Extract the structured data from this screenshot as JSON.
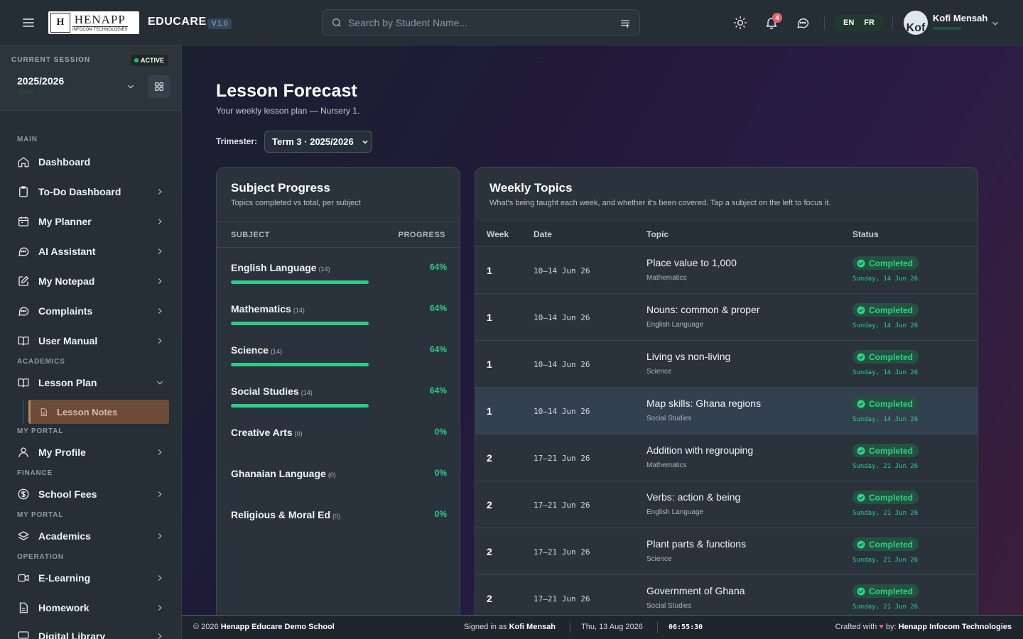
{
  "header": {
    "logo": {
      "mark": "H",
      "main": "HENAPP",
      "sub": "INFOCOM TECHNOLOGIES"
    },
    "brand": "EDUCARE",
    "version": "V.1.0",
    "search_placeholder": "Search by Student Name...",
    "notification_count": "4",
    "languages": [
      "EN",
      "FR"
    ],
    "user_name": "Kofi Mensah",
    "avatar_initials": "Kof"
  },
  "session": {
    "label": "CURRENT SESSION",
    "status": "ACTIVE",
    "year": "2025/2026",
    "term": "Term 3"
  },
  "sidebar": {
    "sections": {
      "main": "MAIN",
      "academics": "ACADEMICS",
      "my_portal": "MY PORTAL",
      "finance": "FINANCE",
      "my_portal_2": "MY PORTAL",
      "operation": "OPERATION"
    },
    "items": [
      {
        "label": "Dashboard",
        "icon": "home-icon"
      },
      {
        "label": "To-Do Dashboard",
        "icon": "clipboard-icon"
      },
      {
        "label": "My Planner",
        "icon": "calendar-icon"
      },
      {
        "label": "AI Assistant",
        "icon": "chat-icon"
      },
      {
        "label": "My Notepad",
        "icon": "edit-icon"
      },
      {
        "label": "Complaints",
        "icon": "chat-icon"
      },
      {
        "label": "User Manual",
        "icon": "book-icon"
      },
      {
        "label": "Lesson Plan",
        "icon": "book-icon"
      },
      {
        "label": "My Profile",
        "icon": "user-icon"
      },
      {
        "label": "School Fees",
        "icon": "dollar-icon"
      },
      {
        "label": "Academics",
        "icon": "layers-icon"
      },
      {
        "label": "E-Learning",
        "icon": "video-icon"
      },
      {
        "label": "Homework",
        "icon": "file-icon"
      },
      {
        "label": "Digital Library",
        "icon": "monitor-icon"
      }
    ],
    "sub_item": {
      "label": "Lesson Notes",
      "icon": "file-icon"
    }
  },
  "page": {
    "title": "Lesson Forecast",
    "subtitle": "Your weekly lesson plan — Nursery 1.",
    "trimester_label": "Trimester:",
    "trimester_value": "Term 3 · 2025/2026"
  },
  "subject_progress": {
    "title": "Subject Progress",
    "subtitle": "Topics completed vs total, per subject",
    "col_subject": "SUBJECT",
    "col_progress": "PROGRESS",
    "rows": [
      {
        "name": "English Language",
        "total": "(14)",
        "pct": "64%",
        "value": 0.64
      },
      {
        "name": "Mathematics",
        "total": "(14)",
        "pct": "64%",
        "value": 0.64
      },
      {
        "name": "Science",
        "total": "(14)",
        "pct": "64%",
        "value": 0.64
      },
      {
        "name": "Social Studies",
        "total": "(14)",
        "pct": "64%",
        "value": 0.64
      },
      {
        "name": "Creative Arts",
        "total": "(0)",
        "pct": "0%",
        "value": 0
      },
      {
        "name": "Ghanaian Language",
        "total": "(0)",
        "pct": "0%",
        "value": 0
      },
      {
        "name": "Religious & Moral Ed",
        "total": "(0)",
        "pct": "0%",
        "value": 0
      }
    ]
  },
  "weekly_topics": {
    "title": "Weekly Topics",
    "subtitle": "What's being taught each week, and whether it's been covered. Tap a subject on the left to focus it.",
    "columns": [
      "Week",
      "Date",
      "Topic",
      "Status"
    ],
    "rows": [
      {
        "week": "1",
        "date": "10–14 Jun 26",
        "topic": "Place value to 1,000",
        "subject": "Mathematics",
        "status": "Completed",
        "done": "Sunday, 14 Jun 26"
      },
      {
        "week": "1",
        "date": "10–14 Jun 26",
        "topic": "Nouns: common & proper",
        "subject": "English Language",
        "status": "Completed",
        "done": "Sunday, 14 Jun 26"
      },
      {
        "week": "1",
        "date": "10–14 Jun 26",
        "topic": "Living vs non-living",
        "subject": "Science",
        "status": "Completed",
        "done": "Sunday, 14 Jun 26"
      },
      {
        "week": "1",
        "date": "10–14 Jun 26",
        "topic": "Map skills: Ghana regions",
        "subject": "Social Studies",
        "status": "Completed",
        "done": "Sunday, 14 Jun 26"
      },
      {
        "week": "2",
        "date": "17–21 Jun 26",
        "topic": "Addition with regrouping",
        "subject": "Mathematics",
        "status": "Completed",
        "done": "Sunday, 21 Jun 26"
      },
      {
        "week": "2",
        "date": "17–21 Jun 26",
        "topic": "Verbs: action & being",
        "subject": "English Language",
        "status": "Completed",
        "done": "Sunday, 21 Jun 26"
      },
      {
        "week": "2",
        "date": "17–21 Jun 26",
        "topic": "Plant parts & functions",
        "subject": "Science",
        "status": "Completed",
        "done": "Sunday, 21 Jun 26"
      },
      {
        "week": "2",
        "date": "17–21 Jun 26",
        "topic": "Government of Ghana",
        "subject": "Social Studies",
        "status": "Completed",
        "done": "Sunday, 21 Jun 26"
      }
    ]
  },
  "footer": {
    "copyright": "© 2026",
    "school": "Henapp Educare Demo School",
    "signed_in_as": "Signed in as",
    "user": "Kofi Mensah",
    "date": "Thu, 13 Aug 2026",
    "time": "06:55:30",
    "crafted_pre": "Crafted with",
    "heart": "♥",
    "crafted_by": "by:",
    "company": "Henapp Infocom Technologies"
  },
  "colors": {
    "accent": "#2ecc87",
    "badge": "#e0646b",
    "active_nav": "#6e4a39"
  }
}
